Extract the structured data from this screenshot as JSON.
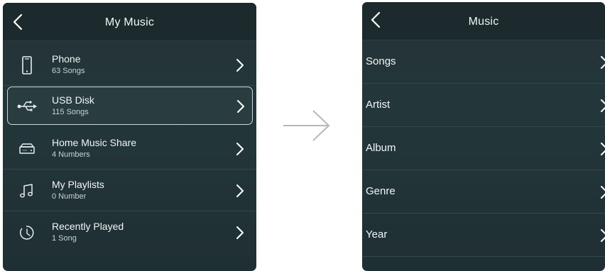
{
  "left_screen": {
    "title": "My Music",
    "items": [
      {
        "name": "Phone",
        "sub": "63  Songs",
        "icon": "phone-icon"
      },
      {
        "name": "USB Disk",
        "sub": "115  Songs",
        "icon": "usb-icon"
      },
      {
        "name": "Home Music Share",
        "sub": "4 Numbers",
        "icon": "nas-drive-icon"
      },
      {
        "name": "My Playlists",
        "sub": "0 Number",
        "icon": "music-note-icon"
      },
      {
        "name": "Recently Played",
        "sub": "1  Song",
        "icon": "clock-history-icon"
      }
    ],
    "selected_item": "USB Disk"
  },
  "right_screen": {
    "title": "Music",
    "items": [
      "Songs",
      "Artist",
      "Album",
      "Genre",
      "Year"
    ]
  },
  "transition": {
    "icon": "right-arrow-icon"
  },
  "colors": {
    "panel_bg": "#23373b",
    "header_bg": "#1c2a2d",
    "text": "#f3f6f7",
    "subtext": "#c9d2d4",
    "arrow": "#b8b8b8"
  }
}
